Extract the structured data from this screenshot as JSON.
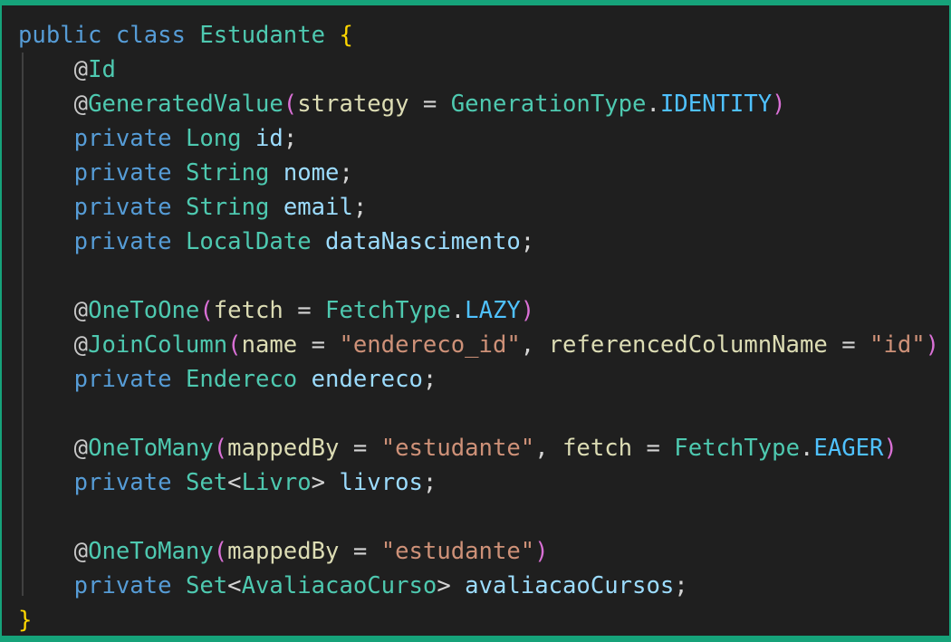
{
  "colors": {
    "border": "#16a37a",
    "background": "#1f1f1f",
    "keyword": "#569cd6",
    "type": "#4ec9b0",
    "string": "#ce9178",
    "variable": "#9cdcfe",
    "enum": "#4fc1ff"
  },
  "lines": [
    [
      [
        "kw",
        "public"
      ],
      [
        "punc",
        " "
      ],
      [
        "kw",
        "class"
      ],
      [
        "punc",
        " "
      ],
      [
        "type",
        "Estudante"
      ],
      [
        "punc",
        " "
      ],
      [
        "brace",
        "{"
      ]
    ],
    [
      [
        "punc",
        "    "
      ],
      [
        "at",
        "@"
      ],
      [
        "ann",
        "Id"
      ]
    ],
    [
      [
        "punc",
        "    "
      ],
      [
        "at",
        "@"
      ],
      [
        "ann",
        "GeneratedValue"
      ],
      [
        "paren",
        "("
      ],
      [
        "param",
        "strategy"
      ],
      [
        "punc",
        " = "
      ],
      [
        "type",
        "GenerationType"
      ],
      [
        "punc",
        "."
      ],
      [
        "enum",
        "IDENTITY"
      ],
      [
        "paren",
        ")"
      ]
    ],
    [
      [
        "punc",
        "    "
      ],
      [
        "kw",
        "private"
      ],
      [
        "punc",
        " "
      ],
      [
        "type",
        "Long"
      ],
      [
        "punc",
        " "
      ],
      [
        "var",
        "id"
      ],
      [
        "punc",
        ";"
      ]
    ],
    [
      [
        "punc",
        "    "
      ],
      [
        "kw",
        "private"
      ],
      [
        "punc",
        " "
      ],
      [
        "type",
        "String"
      ],
      [
        "punc",
        " "
      ],
      [
        "var",
        "nome"
      ],
      [
        "punc",
        ";"
      ]
    ],
    [
      [
        "punc",
        "    "
      ],
      [
        "kw",
        "private"
      ],
      [
        "punc",
        " "
      ],
      [
        "type",
        "String"
      ],
      [
        "punc",
        " "
      ],
      [
        "var",
        "email"
      ],
      [
        "punc",
        ";"
      ]
    ],
    [
      [
        "punc",
        "    "
      ],
      [
        "kw",
        "private"
      ],
      [
        "punc",
        " "
      ],
      [
        "type",
        "LocalDate"
      ],
      [
        "punc",
        " "
      ],
      [
        "var",
        "dataNascimento"
      ],
      [
        "punc",
        ";"
      ]
    ],
    [],
    [
      [
        "punc",
        "    "
      ],
      [
        "at",
        "@"
      ],
      [
        "ann",
        "OneToOne"
      ],
      [
        "paren",
        "("
      ],
      [
        "param",
        "fetch"
      ],
      [
        "punc",
        " = "
      ],
      [
        "type",
        "FetchType"
      ],
      [
        "punc",
        "."
      ],
      [
        "enum",
        "LAZY"
      ],
      [
        "paren",
        ")"
      ]
    ],
    [
      [
        "punc",
        "    "
      ],
      [
        "at",
        "@"
      ],
      [
        "ann",
        "JoinColumn"
      ],
      [
        "paren",
        "("
      ],
      [
        "param",
        "name"
      ],
      [
        "punc",
        " = "
      ],
      [
        "str",
        "\"endereco_id\""
      ],
      [
        "punc",
        ", "
      ],
      [
        "param",
        "referencedColumnName"
      ],
      [
        "punc",
        " = "
      ],
      [
        "str",
        "\"id\""
      ],
      [
        "paren",
        ")"
      ]
    ],
    [
      [
        "punc",
        "    "
      ],
      [
        "kw",
        "private"
      ],
      [
        "punc",
        " "
      ],
      [
        "type",
        "Endereco"
      ],
      [
        "punc",
        " "
      ],
      [
        "var",
        "endereco"
      ],
      [
        "punc",
        ";"
      ]
    ],
    [],
    [
      [
        "punc",
        "    "
      ],
      [
        "at",
        "@"
      ],
      [
        "ann",
        "OneToMany"
      ],
      [
        "paren",
        "("
      ],
      [
        "param",
        "mappedBy"
      ],
      [
        "punc",
        " = "
      ],
      [
        "str",
        "\"estudante\""
      ],
      [
        "punc",
        ", "
      ],
      [
        "param",
        "fetch"
      ],
      [
        "punc",
        " = "
      ],
      [
        "type",
        "FetchType"
      ],
      [
        "punc",
        "."
      ],
      [
        "enum",
        "EAGER"
      ],
      [
        "paren",
        ")"
      ]
    ],
    [
      [
        "punc",
        "    "
      ],
      [
        "kw",
        "private"
      ],
      [
        "punc",
        " "
      ],
      [
        "type",
        "Set"
      ],
      [
        "punc",
        "<"
      ],
      [
        "type",
        "Livro"
      ],
      [
        "punc",
        "> "
      ],
      [
        "var",
        "livros"
      ],
      [
        "punc",
        ";"
      ]
    ],
    [],
    [
      [
        "punc",
        "    "
      ],
      [
        "at",
        "@"
      ],
      [
        "ann",
        "OneToMany"
      ],
      [
        "paren",
        "("
      ],
      [
        "param",
        "mappedBy"
      ],
      [
        "punc",
        " = "
      ],
      [
        "str",
        "\"estudante\""
      ],
      [
        "paren",
        ")"
      ]
    ],
    [
      [
        "punc",
        "    "
      ],
      [
        "kw",
        "private"
      ],
      [
        "punc",
        " "
      ],
      [
        "type",
        "Set"
      ],
      [
        "punc",
        "<"
      ],
      [
        "type",
        "AvaliacaoCurso"
      ],
      [
        "punc",
        "> "
      ],
      [
        "var",
        "avaliacaoCursos"
      ],
      [
        "punc",
        ";"
      ]
    ],
    [
      [
        "brace",
        "}"
      ]
    ]
  ]
}
